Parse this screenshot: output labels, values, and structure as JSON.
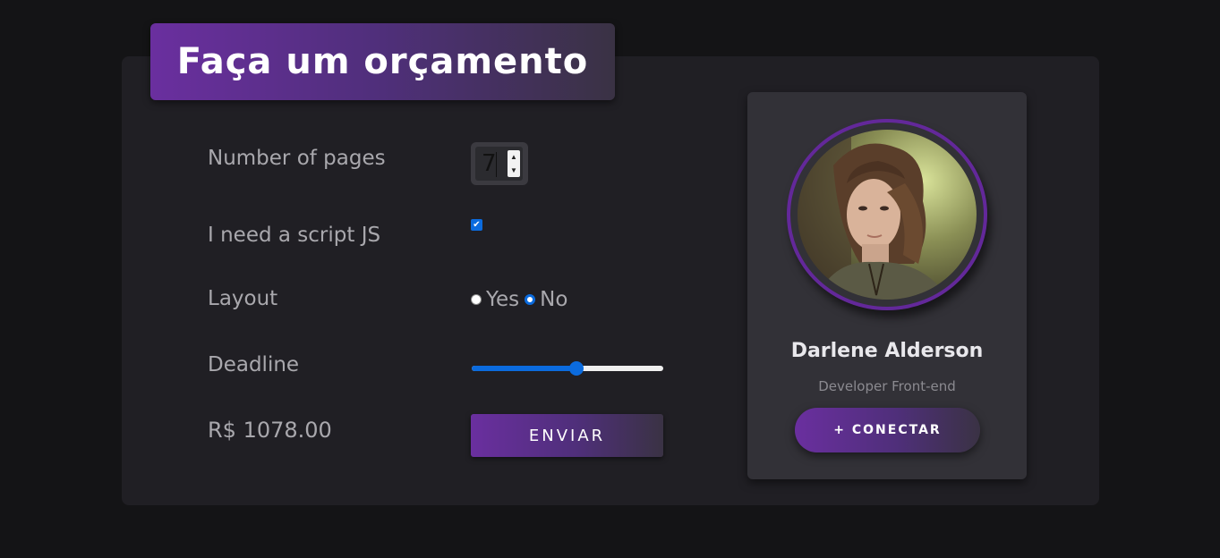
{
  "title": "Faça um orçamento",
  "form": {
    "pages_label": "Number of pages",
    "pages_value": "7",
    "script_label": "I need a script JS",
    "script_checked": true,
    "layout_label": "Layout",
    "layout_options": [
      "Yes",
      "No"
    ],
    "layout_selected": "No",
    "deadline_label": "Deadline",
    "deadline_level": 0.55,
    "price": "R$ 1078.00",
    "submit_label": "ENVIAR"
  },
  "profile": {
    "name": "Darlene Alderson",
    "role": "Developer Front-end",
    "connect_label": "+ CONECTAR",
    "accent_color": "#63289a"
  },
  "colors": {
    "background": "#141416",
    "card": "#201f24",
    "gradient_start": "#6a2f9f",
    "gradient_end": "#3a3244",
    "control_blue": "#0b6bde"
  }
}
